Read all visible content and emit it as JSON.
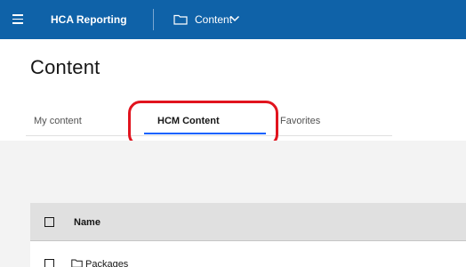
{
  "header": {
    "app_title": "HCA Reporting",
    "breadcrumb": "Content",
    "icons": {
      "menu": "hamburger-icon",
      "folder": "folder-icon",
      "dropdown": "chevron-down-icon"
    },
    "bar_color": "#0f62a8"
  },
  "page": {
    "title": "Content"
  },
  "tabs": [
    {
      "label": "My content",
      "active": false
    },
    {
      "label": "HCM Content",
      "active": true
    },
    {
      "label": "Favorites",
      "active": false
    }
  ],
  "annotation": {
    "color": "#e1141e",
    "target": "HCM Content tab"
  },
  "table": {
    "columns": [
      "Name"
    ],
    "rows": [
      {
        "name": "Packages",
        "icon": "folder-icon"
      }
    ]
  }
}
